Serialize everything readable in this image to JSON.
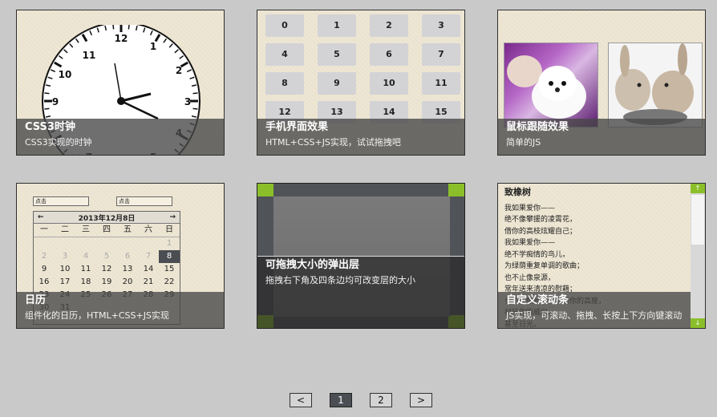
{
  "cards": [
    {
      "title": "CSS3时钟",
      "subtitle": "CSS3实现的时钟"
    },
    {
      "title": "手机界面效果",
      "subtitle": "HTML+CSS+JS实现，试试拖拽吧"
    },
    {
      "title": "鼠标跟随效果",
      "subtitle": "简单的JS"
    },
    {
      "title": "日历",
      "subtitle": "组件化的日历，HTML+CSS+JS实现"
    },
    {
      "title": "可拖拽大小的弹出层",
      "subtitle": "拖拽右下角及四条边均可改变层的大小"
    },
    {
      "title": "自定义滚动条",
      "subtitle": "JS实现，可滚动、拖拽、长按上下方向键滚动"
    }
  ],
  "clock": {
    "numbers": [
      "12",
      "1",
      "2",
      "3",
      "4",
      "5",
      "6",
      "7",
      "8",
      "9",
      "10",
      "11"
    ]
  },
  "phone_grid": [
    "0",
    "1",
    "2",
    "3",
    "4",
    "5",
    "6",
    "7",
    "8",
    "9",
    "10",
    "11",
    "12",
    "13",
    "14",
    "15"
  ],
  "calendar": {
    "input1": "点击",
    "input2": "点击",
    "prev": "←",
    "next": "→",
    "month": "2013年12月8日",
    "weekdays": [
      "一",
      "二",
      "三",
      "四",
      "五",
      "六",
      "日"
    ],
    "days": [
      "",
      "",
      "",
      "",
      "",
      "",
      "1",
      "2",
      "3",
      "4",
      "5",
      "6",
      "7",
      "8",
      "9",
      "10",
      "11",
      "12",
      "13",
      "14",
      "15",
      "16",
      "17",
      "18",
      "19",
      "20",
      "21",
      "22",
      "23",
      "24",
      "25",
      "26",
      "27",
      "28",
      "29",
      "30",
      "31"
    ],
    "selected": "8"
  },
  "poem": {
    "title": "致橡树",
    "lines": [
      "我如果爱你——",
      "绝不像攀援的凌霄花，",
      "借你的高枝炫耀自己；",
      "我如果爱你——",
      "绝不学痴情的鸟儿，",
      "为绿荫重复单调的歌曲；",
      "也不止像泉源，",
      "常年送来清凉的慰藉；",
      "也不止像险峰，增加你的高度，",
      "衬托你的威仪。",
      "甚至日光，",
      "甚至春雨。"
    ]
  },
  "scrollbar": {
    "up": "↑",
    "down": "↓"
  },
  "pagination": {
    "prev": "<",
    "pages": [
      "1",
      "2"
    ],
    "next": ">",
    "current": "1"
  },
  "colors": {
    "accent": "#8bbf2a",
    "caption_bg": "#464646",
    "selected_day": "#4a4e52",
    "page_bg": "#c9c9c9"
  }
}
